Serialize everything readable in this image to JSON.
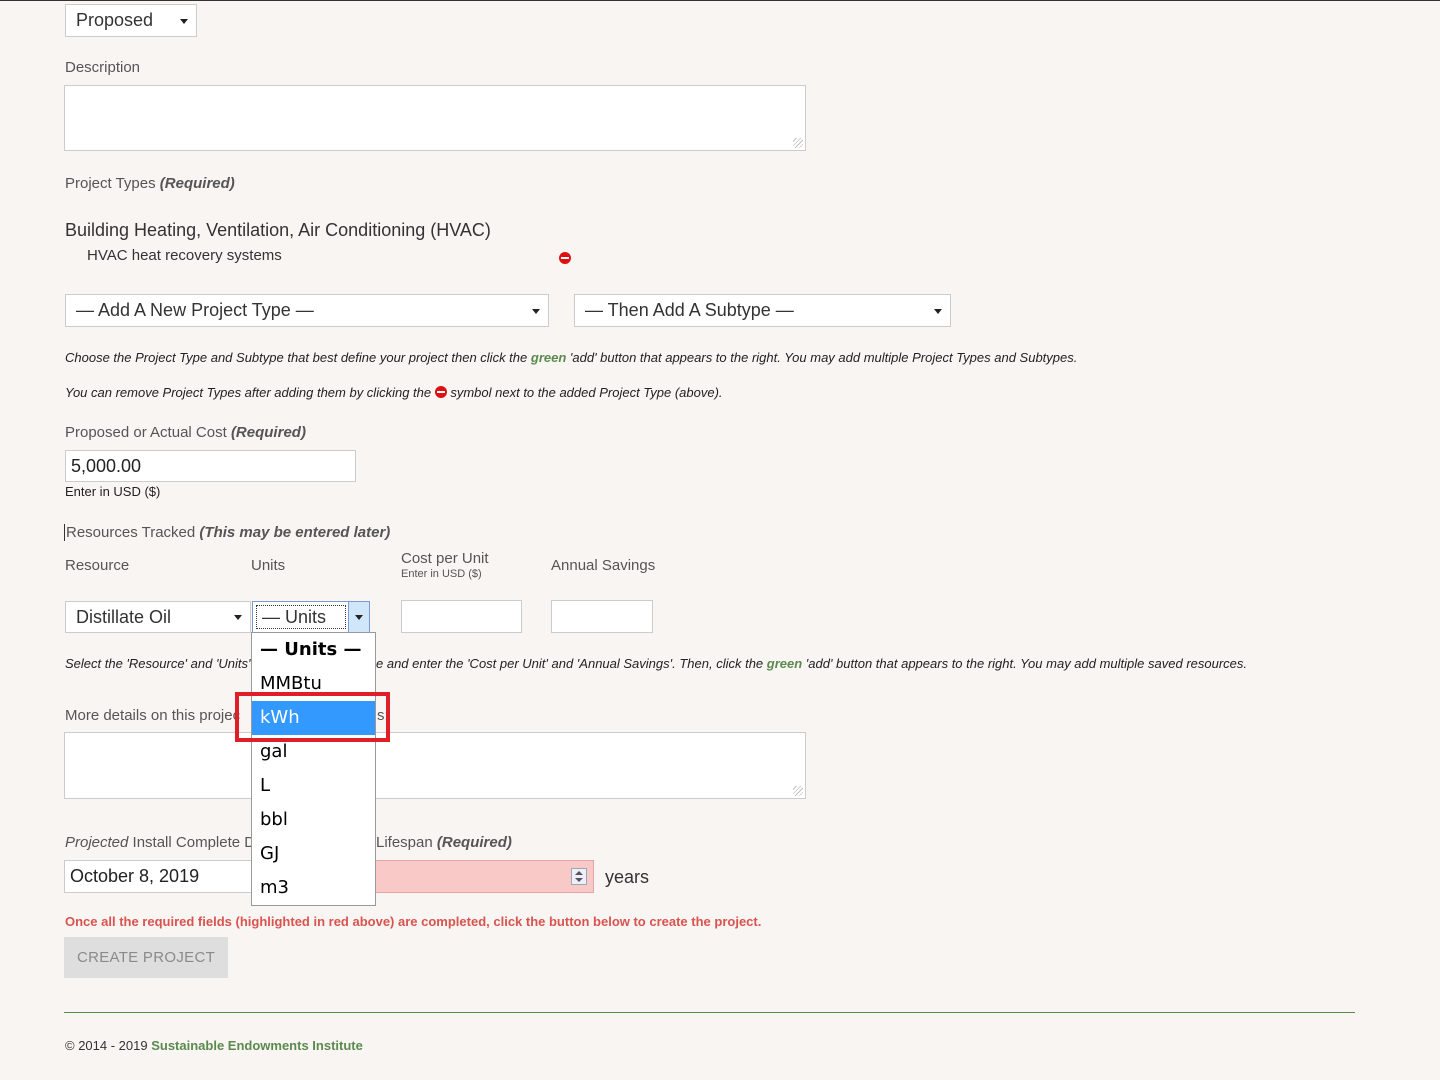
{
  "status_select": {
    "value": "Proposed"
  },
  "description": {
    "label": "Description"
  },
  "project_types": {
    "label": "Project Types",
    "required": "(Required)",
    "category": "Building Heating, Ventilation, Air Conditioning (HVAC)",
    "subtype": "HVAC heat recovery systems",
    "type_select": "— Add A New Project Type —",
    "subtype_select": "— Then Add A Subtype —",
    "help1_a": "Choose the Project Type and Subtype that best define your project then click the ",
    "help1_green": "green",
    "help1_b": " 'add' button that appears to the right. You may add multiple Project Types and Subtypes.",
    "help2_a": "You can remove Project Types after adding them by clicking the ",
    "help2_b": " symbol next to the added Project Type (above)."
  },
  "cost": {
    "label": "Proposed or Actual Cost",
    "required": "(Required)",
    "value": "5,000.00",
    "hint": "Enter in USD ($)"
  },
  "resources": {
    "label": "Resources Tracked",
    "later": "(This may be entered later)",
    "col_resource": "Resource",
    "col_units": "Units",
    "col_cost": "Cost per Unit",
    "col_cost_hint": "Enter in USD ($)",
    "col_savings": "Annual Savings",
    "resource_value": "Distillate Oil",
    "units_value": "— Units —",
    "help_a": "Select the 'Resource' and 'Units'",
    "help_b": "e and enter the 'Cost per Unit' and 'Annual Savings'. Then, click the ",
    "help_green": "green",
    "help_c": " 'add' button that appears to the right. You may add multiple saved resources."
  },
  "units_dropdown": {
    "options": [
      "— Units —",
      "MMBtu",
      "kWh",
      "gal",
      "L",
      "bbl",
      "GJ",
      "m3"
    ],
    "selected_index": 2
  },
  "details": {
    "label_a": "More details on this projec",
    "label_b": "s:"
  },
  "install": {
    "label_italic": "Projected",
    "label_rest": " Install Complete D",
    "date_value": "October 8, 2019",
    "lifespan_label": "Lifespan",
    "lifespan_required": "(Required)",
    "years": "years"
  },
  "warning": "Once all the required fields (highlighted in red above) are completed, click the button below to create the project.",
  "create_button": "CREATE PROJECT",
  "footer": {
    "copyright": "© 2014 - 2019 ",
    "org": "Sustainable Endowments Institute"
  },
  "colors": {
    "highlight": "#e01e2a",
    "selected": "#3399ff",
    "green": "#5a8a4e",
    "warning": "#d9534f"
  }
}
